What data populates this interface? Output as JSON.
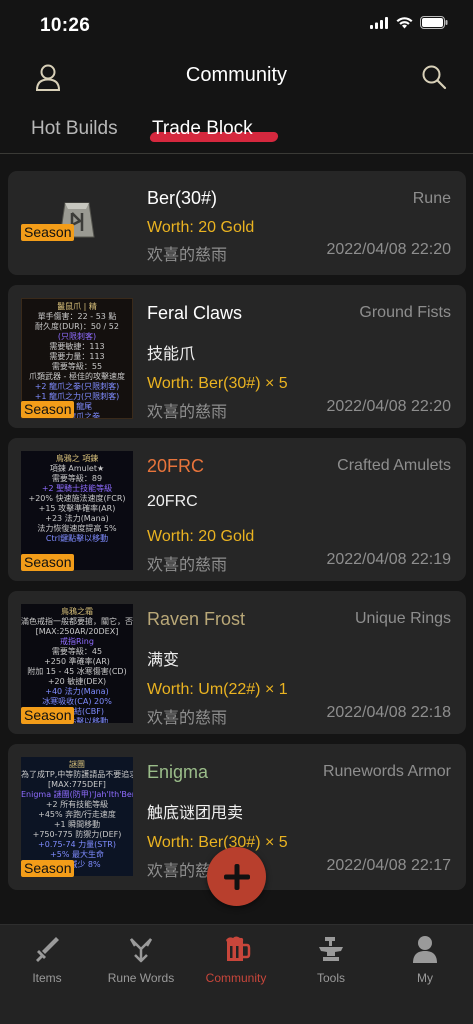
{
  "status": {
    "time": "10:26"
  },
  "header": {
    "title": "Community"
  },
  "tabs": [
    {
      "label": "Hot Builds",
      "active": false
    },
    {
      "label": "Trade Block",
      "active": true
    }
  ],
  "colors": {
    "accent": "#d5283e",
    "gold": "#eab321",
    "season": "#f39d19",
    "fab": "#b83f2d",
    "nav_active": "#c8463b",
    "magic_orange": "#e8743b",
    "unique": "#b9a878",
    "set_green": "#9bbd8a"
  },
  "posts": [
    {
      "name": "Ber(30#)",
      "name_color": "#ffffff",
      "category": "Rune",
      "description": "",
      "worth": "Worth: 20 Gold",
      "user": "欢喜的慈雨",
      "date": "2022/04/08 22:20",
      "season": "Season",
      "thumb_lines": []
    },
    {
      "name": "Feral Claws",
      "name_color": "#ffffff",
      "category": "Ground Fists",
      "description": "技能爪",
      "worth": "Worth: Ber(30#) × 5",
      "user": "欢喜的慈雨",
      "date": "2022/04/08 22:20",
      "season": "Season",
      "thumb_lines": [
        "鬣鼠爪 | 精",
        "單手傷害：22 - 53 點",
        "耐久度(DUR)：50 / 52",
        "(只限刺客)",
        "需要敏捷：113",
        "需要力量：113",
        "需要等級：55",
        "爪類武器 - 極佳的攻擊速度",
        "+2 龍爪之拳(只限刺客)",
        "+1 龍爪之力(只限刺客)",
        "+3 龍尾",
        "+1 龍爪之拳",
        "無法破壞(無法以移動"
      ]
    },
    {
      "name": "20FRC",
      "name_color": "#e8743b",
      "category": "Crafted Amulets",
      "description": "20FRC",
      "worth": "Worth: 20 Gold",
      "user": "欢喜的慈雨",
      "date": "2022/04/08 22:19",
      "season": "Season",
      "thumb_lines": [
        "鳥鴉之 項鍊",
        "項鍊 Amulet★",
        "需要等級：89",
        "+2 聖騎士技能等級",
        "+20% 快速施法速度(FCR)",
        "+15 攻擊準確率(AR)",
        "+23 法力(Mana)",
        "法力恢復速度提高 5%",
        "Ctrl鍵點擊以移動"
      ]
    },
    {
      "name": "Raven Frost",
      "name_color": "#b9a878",
      "category": "Unique Rings",
      "description": "满变",
      "worth": "Worth: Um(22#) × 1",
      "user": "欢喜的慈雨",
      "date": "2022/04/08 22:18",
      "season": "Season",
      "thumb_lines": [
        "鳥鴉之霜",
        "滿色戒指一般都要搶，關它，否則",
        "[MAX:250AR/20DEX]",
        "戒指Ring",
        "需要等級：45",
        "+250 準確率(AR)",
        "附加 15 - 45 冰寒傷害(CD)",
        "+20 敏捷(DEX)",
        "+40 法力(Mana)",
        "冰寒吸收(CA) 20%",
        "無法冰結(CBF)",
        "Ctrl鍵點擊以移動"
      ]
    },
    {
      "name": "Enigma",
      "name_color": "#9bbd8a",
      "category": "Runewords Armor",
      "description": "触底谜团甩卖",
      "worth": "Worth: Ber(30#) × 5",
      "user": "欢喜的慈雨",
      "date": "2022/04/08 22:17",
      "season": "Season",
      "thumb_lines": [
        "謎團",
        "為了成TP,中等防護請品不要追求最大值啊啊?",
        "[MAX:775DEF]",
        "Enigma 謎團(防甲)'Jah'Ith'Ber'",
        "+2 所有技能等級",
        "+45% 奔跑/行走速度",
        "+1 瞬間移動",
        "+750-775 防禦力(DEF)",
        "+0.75-74 力量(STR)",
        "+5% 最大生命",
        "傷害減少 8%"
      ]
    }
  ],
  "fab": {
    "label": "+"
  },
  "nav": [
    {
      "label": "Items",
      "icon": "sword-icon",
      "active": false
    },
    {
      "label": "Rune Words",
      "icon": "rune-icon",
      "active": false
    },
    {
      "label": "Community",
      "icon": "beer-mug-icon",
      "active": true
    },
    {
      "label": "Tools",
      "icon": "anvil-icon",
      "active": false
    },
    {
      "label": "My",
      "icon": "person-icon",
      "active": false
    }
  ]
}
